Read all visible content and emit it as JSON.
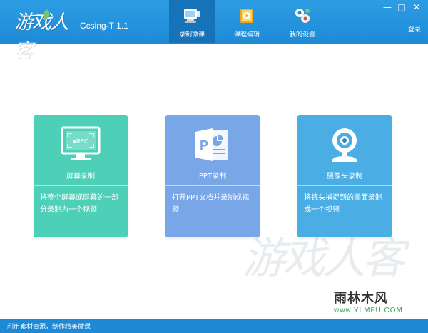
{
  "colors": {
    "header": "#1e8ad6",
    "tab_active": "#1673b9",
    "card_screen": "#4ecfb7",
    "card_ppt": "#78a6e6",
    "card_camera": "#4aaee4",
    "footer": "#1e8ad6"
  },
  "header": {
    "logo_text": "游戏人客",
    "app_title": "Ccsing-T 1.1",
    "tabs": [
      {
        "label": "录制微课",
        "icon": "recorder-icon",
        "active": true
      },
      {
        "label": "课程编辑",
        "icon": "course-edit-icon",
        "active": false
      },
      {
        "label": "我的设置",
        "icon": "settings-gears-icon",
        "active": false
      }
    ],
    "window_controls": {
      "minimize": "—",
      "maximize": "□",
      "close": "✕"
    },
    "login": "登录"
  },
  "cards": [
    {
      "title": "屏幕录制",
      "desc": "将整个屏幕或屏幕的一部分录制为一个视频",
      "icon": "monitor-rec-icon",
      "icon_label": "●REC"
    },
    {
      "title": "PPT录制",
      "desc": "打开PPT文档并录制成视频",
      "icon": "powerpoint-icon",
      "icon_label": "P"
    },
    {
      "title": "摄像头录制",
      "desc": "将镜头捕捉到的画面录制成一个视频",
      "icon": "webcam-icon"
    }
  ],
  "watermark": {
    "text": "游戏人客"
  },
  "site_logo": {
    "brand": "雨林木风",
    "url": "www.YLMFU.COM"
  },
  "footer": {
    "text": "利用素材资源，制作精美微课"
  }
}
